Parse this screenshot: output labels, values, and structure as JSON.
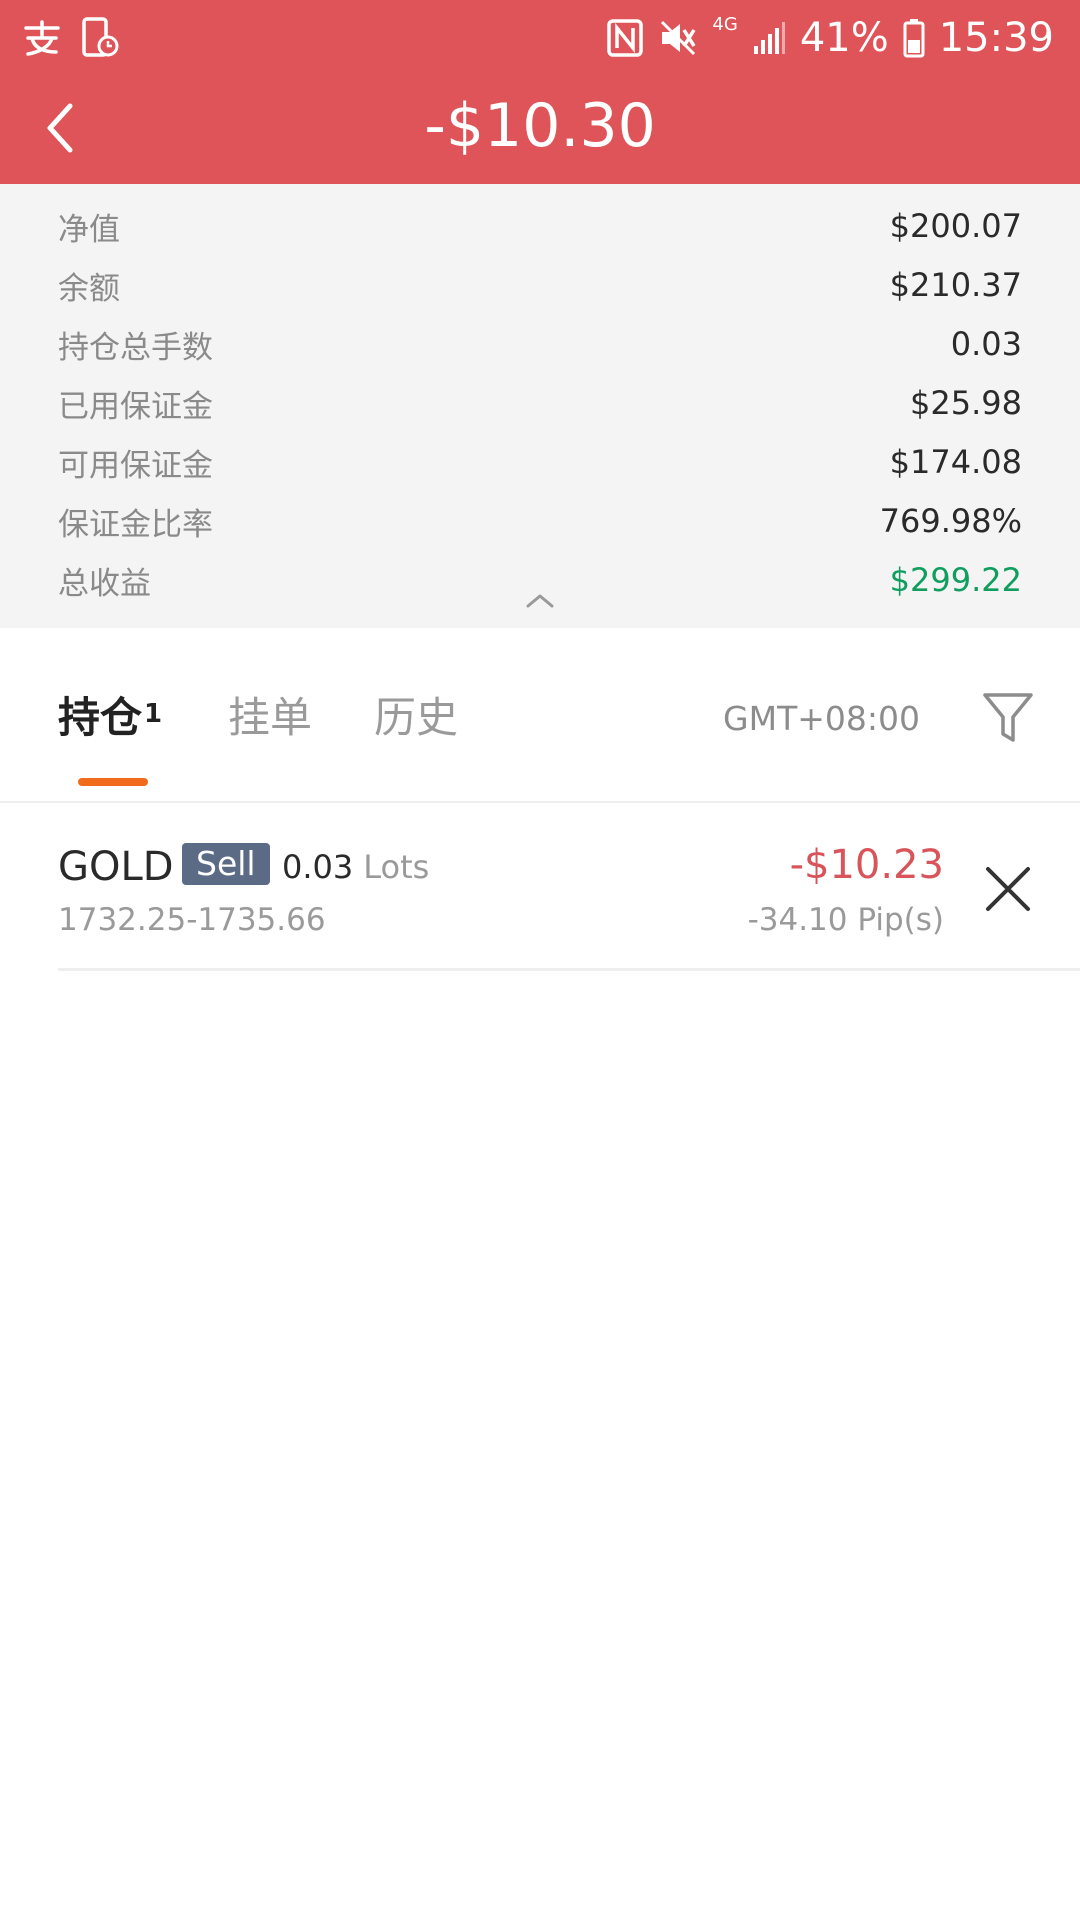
{
  "status_bar": {
    "battery": "41%",
    "time": "15:39",
    "network": "4G",
    "icons": [
      "alipay-icon",
      "device-clock-icon",
      "nfc-icon",
      "mute-icon",
      "signal-icon",
      "battery-icon"
    ]
  },
  "header": {
    "title": "-$10.30",
    "background_color": "#df5458"
  },
  "summary": {
    "rows": [
      {
        "label": "净值",
        "value": "$200.07"
      },
      {
        "label": "余额",
        "value": "$210.37"
      },
      {
        "label": "持仓总手数",
        "value": "0.03"
      },
      {
        "label": "已用保证金",
        "value": "$25.98"
      },
      {
        "label": "可用保证金",
        "value": "$174.08"
      },
      {
        "label": "保证金比率",
        "value": "769.98%"
      },
      {
        "label": "总收益",
        "value": "$299.22"
      }
    ],
    "positive_color": "#0f9e5e"
  },
  "tabs": {
    "items": [
      {
        "label": "持仓",
        "badge": "1"
      },
      {
        "label": "挂单"
      },
      {
        "label": "历史"
      }
    ],
    "active_index": 0,
    "timezone": "GMT+08:00",
    "accent_color": "#f26a1b"
  },
  "positions": [
    {
      "symbol": "GOLD",
      "side": "Sell",
      "lots": "0.03",
      "lots_unit": "Lots",
      "prices": "1732.25-1735.66",
      "pnl": "-$10.23",
      "pips": "-34.10 Pip(s)"
    }
  ]
}
